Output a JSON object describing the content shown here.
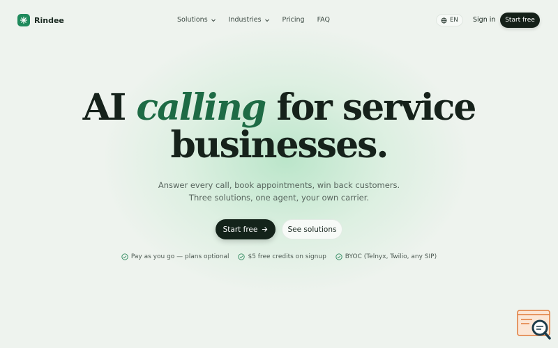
{
  "brand": {
    "name": "Rindee",
    "icon": "sparkle-icon",
    "color": "#1f8a5c"
  },
  "nav": {
    "items": [
      {
        "label": "Solutions",
        "dropdown": true
      },
      {
        "label": "Industries",
        "dropdown": true
      },
      {
        "label": "Pricing",
        "dropdown": false
      },
      {
        "label": "FAQ",
        "dropdown": false
      }
    ]
  },
  "header": {
    "language": "EN",
    "language_icon": "globe-icon",
    "sign_in": "Sign in",
    "start_free": "Start free"
  },
  "hero": {
    "headline_pre": "AI",
    "headline_accent": "calling",
    "headline_post": "for service",
    "headline_line2": "businesses.",
    "subheadline": "Answer every call, book appointments, win back customers. Three solutions, one agent, your own carrier.",
    "primary_cta": "Start free",
    "primary_cta_icon": "arrow-right-icon",
    "secondary_cta": "See solutions"
  },
  "features": [
    {
      "label": "Pay as you go — plans optional",
      "icon": "check-circle-icon"
    },
    {
      "label": "$5 free credits on signup",
      "icon": "check-circle-icon"
    },
    {
      "label": "BYOC (Telnyx, Twilio, any SIP)",
      "icon": "check-circle-icon"
    }
  ],
  "colors": {
    "background": "#eef3ee",
    "accent": "#1e6b45",
    "dark_button": "#14231a"
  },
  "widget": {
    "icon": "chat-search-icon"
  }
}
